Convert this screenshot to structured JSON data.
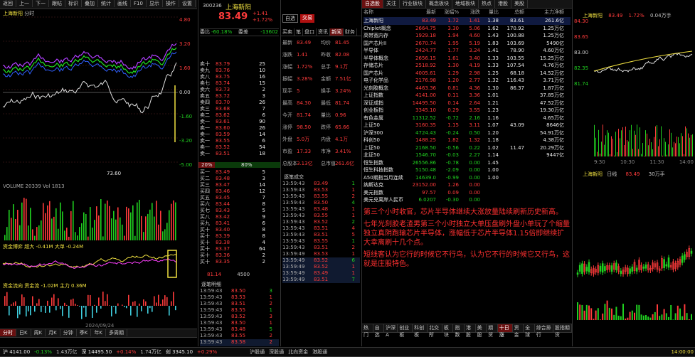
{
  "left_toolbar": [
    "返回",
    "上一",
    "下一",
    "跟帖",
    "标识",
    "叠加",
    "统计",
    "画线",
    "F10",
    "显示",
    "操作",
    "设置"
  ],
  "left_chart": {
    "title": "上海新阳",
    "period": "分时",
    "price_labels": [
      "4.80",
      "3.20",
      "1.60",
      "0.00",
      "-1.60",
      "-3.20",
      "-5.00"
    ],
    "low_label": "73.60",
    "volume_caption": "VOLUME 20339 Vol 1813",
    "ind1_caption": "资金博弈 超大 -0.41M 大单 -0.24M",
    "ind2_caption": "资金流向 资金流 -1.02M 主力 0.36M",
    "date_label": "2024/09/24",
    "bottom_tabs": [
      "分时",
      "日K",
      "周K",
      "月K",
      "分钟",
      "季K",
      "年K",
      "多周期"
    ]
  },
  "stock_header": {
    "code": "300236",
    "name": "上海新阳",
    "price": "83.49",
    "change": "+1.41",
    "change_pct": "+1.72%",
    "buttons": [
      "自选",
      "交易"
    ]
  },
  "trade_tabs": [
    "买卖",
    "笔",
    "盘口",
    "资讯",
    "新闻",
    "财务"
  ],
  "order_book_header": {
    "weibi": "-60.18%",
    "weicha": "-13602",
    "col_a": "委比",
    "col_b": "委差"
  },
  "sell_orders": [
    {
      "label": "卖十",
      "price": "83.79",
      "vol": "25"
    },
    {
      "label": "卖九",
      "price": "83.76",
      "vol": "10"
    },
    {
      "label": "卖八",
      "price": "83.75",
      "vol": "16"
    },
    {
      "label": "卖七",
      "price": "83.74",
      "vol": "15"
    },
    {
      "label": "卖六",
      "price": "83.73",
      "vol": "2"
    },
    {
      "label": "卖五",
      "price": "83.72",
      "vol": "3"
    },
    {
      "label": "卖四",
      "price": "83.70",
      "vol": "26"
    },
    {
      "label": "卖三",
      "price": "83.68",
      "vol": "7"
    },
    {
      "label": "卖二",
      "price": "83.62",
      "vol": "6"
    },
    {
      "label": "卖一",
      "price": "83.61",
      "vol": "90"
    },
    {
      "label": "卖一",
      "price": "83.60",
      "vol": "26"
    },
    {
      "label": "卖一",
      "price": "83.59",
      "vol": "14"
    },
    {
      "label": "卖一",
      "price": "83.55",
      "vol": "6"
    },
    {
      "label": "卖一",
      "price": "83.52",
      "vol": "54"
    },
    {
      "label": "卖一",
      "price": "83.51",
      "vol": "18"
    }
  ],
  "buy_orders": [
    {
      "label": "买一",
      "price": "83.49",
      "vol": "5"
    },
    {
      "label": "买二",
      "price": "83.48",
      "vol": "3"
    },
    {
      "label": "买三",
      "price": "83.47",
      "vol": "14"
    },
    {
      "label": "买四",
      "price": "83.46",
      "vol": "12"
    },
    {
      "label": "买五",
      "price": "83.45",
      "vol": "7"
    },
    {
      "label": "买六",
      "price": "83.44",
      "vol": "8"
    },
    {
      "label": "买七",
      "price": "83.43",
      "vol": "5"
    },
    {
      "label": "买八",
      "price": "83.42",
      "vol": "9"
    },
    {
      "label": "买九",
      "price": "83.41",
      "vol": "6"
    },
    {
      "label": "买十",
      "price": "83.40",
      "vol": "8"
    },
    {
      "label": "买十",
      "price": "83.39",
      "vol": "8"
    },
    {
      "label": "买十",
      "price": "83.38",
      "vol": "4"
    },
    {
      "label": "买十",
      "price": "83.37",
      "vol": "64"
    },
    {
      "label": "买十",
      "price": "83.36",
      "vol": "2"
    },
    {
      "label": "买十",
      "price": "83.35",
      "vol": "2"
    }
  ],
  "ratio_bar": {
    "left": "20%",
    "right": "80%"
  },
  "summary_row": {
    "a": "81.14",
    "b": "4500"
  },
  "quote_fields": [
    {
      "k": "最新",
      "v": "83.49"
    },
    {
      "k": "均价",
      "v": "81.45"
    },
    {
      "k": "涨跌",
      "v": "1.41"
    },
    {
      "k": "昨收",
      "v": "82.08"
    },
    {
      "k": "涨幅",
      "v": "1.72%"
    },
    {
      "k": "总手",
      "v": "9.1万"
    },
    {
      "k": "振幅",
      "v": "3.28%"
    },
    {
      "k": "金额",
      "v": "7.51亿"
    },
    {
      "k": "现手",
      "v": "5"
    },
    {
      "k": "换手",
      "v": "3.24%"
    },
    {
      "k": "最高",
      "v": "84.30"
    },
    {
      "k": "最低",
      "v": "81.74"
    },
    {
      "k": "今开",
      "v": "81.74"
    },
    {
      "k": "量比",
      "v": "0.96"
    },
    {
      "k": "涨停",
      "v": "98.50"
    },
    {
      "k": "跌停",
      "v": "65.66"
    },
    {
      "k": "外盘",
      "v": "5.0万"
    },
    {
      "k": "内盘",
      "v": "4.1万"
    },
    {
      "k": "市盈",
      "v": "17.33"
    },
    {
      "k": "市净",
      "v": "3.41%"
    },
    {
      "k": "总股本",
      "v": "3.13亿"
    },
    {
      "k": "总市值",
      "v": "261.6亿"
    }
  ],
  "time_sales_title": "逐笔成交",
  "time_sales": [
    {
      "t": "13:59:43",
      "p": "83.49",
      "v": "1"
    },
    {
      "t": "13:59:43",
      "p": "83.53",
      "v": "1"
    },
    {
      "t": "13:59:43",
      "p": "83.55",
      "v": "2"
    },
    {
      "t": "13:59:43",
      "p": "83.50",
      "v": "4"
    },
    {
      "t": "13:59:43",
      "p": "83.48",
      "v": "1"
    },
    {
      "t": "13:59:43",
      "p": "83.55",
      "v": "1"
    },
    {
      "t": "13:59:43",
      "p": "83.52",
      "v": "2"
    },
    {
      "t": "13:59:43",
      "p": "83.51",
      "v": "4"
    },
    {
      "t": "13:59:43",
      "p": "83.51",
      "v": "5"
    },
    {
      "t": "13:59:43",
      "p": "83.55",
      "v": "1"
    },
    {
      "t": "13:59:43",
      "p": "83.51",
      "v": "2"
    },
    {
      "t": "13:59:49",
      "p": "83.53",
      "v": "1"
    },
    {
      "t": "13:59:49",
      "p": "83.52",
      "v": "6"
    },
    {
      "t": "13:59:49",
      "p": "83.52",
      "v": "1"
    },
    {
      "t": "13:59:49",
      "p": "83.49",
      "v": "1"
    },
    {
      "t": "13:59:49",
      "p": "83.51",
      "v": "7"
    }
  ],
  "time_sales2_title": "逐笔明细",
  "time_sales2": [
    {
      "t": "13:59:43",
      "p": "83.50",
      "v": "3"
    },
    {
      "t": "13:59:43",
      "p": "83.53",
      "v": "1"
    },
    {
      "t": "13:59:43",
      "p": "83.51",
      "v": "2"
    },
    {
      "t": "13:59:43",
      "p": "83.55",
      "v": "1"
    },
    {
      "t": "13:59:43",
      "p": "83.52",
      "v": "3"
    },
    {
      "t": "13:59:43",
      "p": "83.50",
      "v": "1"
    },
    {
      "t": "13:59:43",
      "p": "83.48",
      "v": "5"
    },
    {
      "t": "13:59:43",
      "p": "83.55",
      "v": "2"
    },
    {
      "t": "13:59:43",
      "p": "83.58",
      "v": "2"
    },
    {
      "t": "13:59:49",
      "p": "83.51",
      "v": "1"
    },
    {
      "t": "13:59:49",
      "p": "83.52",
      "v": "4"
    },
    {
      "t": "13:59:49",
      "p": "83.49",
      "v": "1"
    }
  ],
  "sector_tabs": [
    "自选股",
    "关注",
    "行业板块",
    "概念板块",
    "地域板块",
    "热点",
    "港股",
    "美股"
  ],
  "sector_header": [
    "名称",
    "最新",
    "涨幅%",
    "涨跌",
    "量比",
    "总额",
    "主力净额"
  ],
  "sectors": [
    {
      "n": "上海新阳",
      "p": "83.49",
      "c": "1.72",
      "d": "1.41",
      "v": "1.38",
      "a": "83.61",
      "m": "261.6亿"
    },
    {
      "n": "Chiplet概念",
      "p": "2664.75",
      "c": "3.30",
      "d": "5.06",
      "v": "1.62",
      "a": "170.92",
      "m": "1.25万亿"
    },
    {
      "n": "高带宽内存",
      "p": "1929.18",
      "c": "1.94",
      "d": "4.60",
      "v": "1.43",
      "a": "100.88",
      "m": "1.25万亿"
    },
    {
      "n": "国产芯片II",
      "p": "2670.74",
      "c": "1.95",
      "d": "5.19",
      "v": "1.83",
      "a": "103.69",
      "m": "5490亿"
    },
    {
      "n": "半导体",
      "p": "2424.77",
      "c": "1.77",
      "d": "3.24",
      "v": "1.41",
      "a": "78.90",
      "m": "4.60万亿"
    },
    {
      "n": "半导体概念",
      "p": "2656.15",
      "c": "1.61",
      "d": "3.40",
      "v": "1.33",
      "a": "103.55",
      "m": "15.25万亿"
    },
    {
      "n": "存储芯片",
      "p": "2518.92",
      "c": "1.30",
      "d": "4.19",
      "v": "1.33",
      "a": "107.54",
      "m": "4.76万亿"
    },
    {
      "n": "国产芯片",
      "p": "4005.61",
      "c": "1.29",
      "d": "2.98",
      "v": "1.25",
      "a": "68.18",
      "m": "14.52万亿"
    },
    {
      "n": "电子化学品",
      "p": "2176.98",
      "c": "1.20",
      "d": "2.77",
      "v": "1.32",
      "a": "116.43",
      "m": "3.71万亿"
    },
    {
      "n": "光刻胶概念",
      "p": "4463.36",
      "c": "0.81",
      "d": "4.36",
      "v": "1.30",
      "a": "86.37",
      "m": "1.87万亿"
    },
    {
      "n": "上证指数",
      "p": "4141.00",
      "c": "0.11",
      "d": "3.36",
      "v": "1.01",
      "a": "",
      "m": "37.85万亿"
    },
    {
      "n": "深证成指",
      "p": "14495.50",
      "c": "0.14",
      "d": "2.64",
      "v": "1.21",
      "a": "",
      "m": "47.52万亿"
    },
    {
      "n": "创业板指",
      "p": "3345.10",
      "c": "0.29",
      "d": "3.55",
      "v": "1.23",
      "a": "",
      "m": "19.30万亿"
    },
    {
      "n": "有色金属",
      "p": "11312.52",
      "c": "-0.72",
      "d": "2.16",
      "v": "1.16",
      "a": "",
      "m": "4.65万亿"
    },
    {
      "n": "上证50",
      "p": "3160.35",
      "c": "1.15",
      "d": "3.11",
      "v": "1.07",
      "a": "43.09",
      "m": "8646亿"
    },
    {
      "n": "沪深300",
      "p": "4724.43",
      "c": "-0.24",
      "d": "0.50",
      "v": "1.20",
      "a": "",
      "m": "54.91万亿"
    },
    {
      "n": "科创50",
      "p": "1488.25",
      "c": "1.82",
      "d": "1.32",
      "v": "1.18",
      "a": "",
      "m": "4.38万亿"
    },
    {
      "n": "上证50",
      "p": "2168.50",
      "c": "-0.56",
      "d": "0.22",
      "v": "1.02",
      "a": "11.47",
      "m": "20.29万亿"
    },
    {
      "n": "北证50",
      "p": "1546.70",
      "c": "-0.03",
      "d": "2.27",
      "v": "1.14",
      "a": "",
      "m": "9447亿"
    },
    {
      "n": "恒生指数",
      "p": "26556.86",
      "c": "-0.78",
      "d": "0.00",
      "v": "1.45",
      "a": "",
      "m": ""
    },
    {
      "n": "恒生科技指数",
      "p": "5150.48",
      "c": "-2.09",
      "d": "0.00",
      "v": "1.00",
      "a": "",
      "m": ""
    },
    {
      "n": "A50期指当月连续",
      "p": "14639.0",
      "c": "-0.99",
      "d": "0.00",
      "v": "1.00",
      "a": "",
      "m": ""
    },
    {
      "n": "纳斯达克",
      "p": "23152.00",
      "c": "1.26",
      "d": "0.00",
      "v": "",
      "a": "",
      "m": ""
    },
    {
      "n": "美元指数",
      "p": "97.57",
      "c": "0.09",
      "d": "0.00",
      "v": "",
      "a": "",
      "m": ""
    },
    {
      "n": "美元兑离岸人民币",
      "p": "6.0207",
      "c": "-0.30",
      "d": "0.00",
      "v": "",
      "a": "",
      "m": ""
    }
  ],
  "commentary": {
    "p1": "第三个小时收官，芯片半导体继续大涨放量陆续刷新历史新高。",
    "p2": "七年光刻胶老渣男第三个小时独立大单压盘刷外盘小单玩了个缩量独立真阴跑输芯片半导体，涨幅低于芯片半导体1.15倍即继续扩大幸离刷十几个点。",
    "p3": "短线客认为它行的时候它不行鸟，认为它不行的时候它又行鸟，这就是庄股特色。"
  },
  "right_mini_top": {
    "title": "上海新阳",
    "price": "83.49",
    "pct": "1.72%",
    "vol": "0.04万手",
    "labels": [
      "84.30",
      "83.65",
      "83.00",
      "82.35",
      "81.74"
    ],
    "times": [
      "9:30",
      "10:30",
      "11:30",
      "14:00"
    ]
  },
  "right_mini_bottom": {
    "title": "上海新阳",
    "period": "日线",
    "price": "83.49",
    "vol": "30万手"
  },
  "mid_bottom_tabs": [
    "热门",
    "自选",
    "沪深A",
    "创业板",
    "科创板",
    "北交所",
    "板块",
    "指数",
    "港股",
    "美股",
    "期货",
    "十日涨",
    "资金",
    "全球",
    "综合排行",
    "股指期货"
  ],
  "status_bar": {
    "sh": "沪 4141.00",
    "sh_pct": "-0.13%",
    "sh_amt": "1.43万亿",
    "sz": "深 14495.50",
    "sz_pct": "+0.14%",
    "sz_amt": "1.74万亿",
    "cy": "创 3345.10",
    "cy_pct": "+0.29%",
    "time": "14:00:00",
    "right_items": [
      "沪股通",
      "深股通",
      "北向资金",
      "港股通"
    ]
  },
  "colors": {
    "up": "#ff3b3b",
    "down": "#20d020",
    "accent": "#f0e040",
    "bg": "#000000",
    "highlight": "#6a1010"
  }
}
